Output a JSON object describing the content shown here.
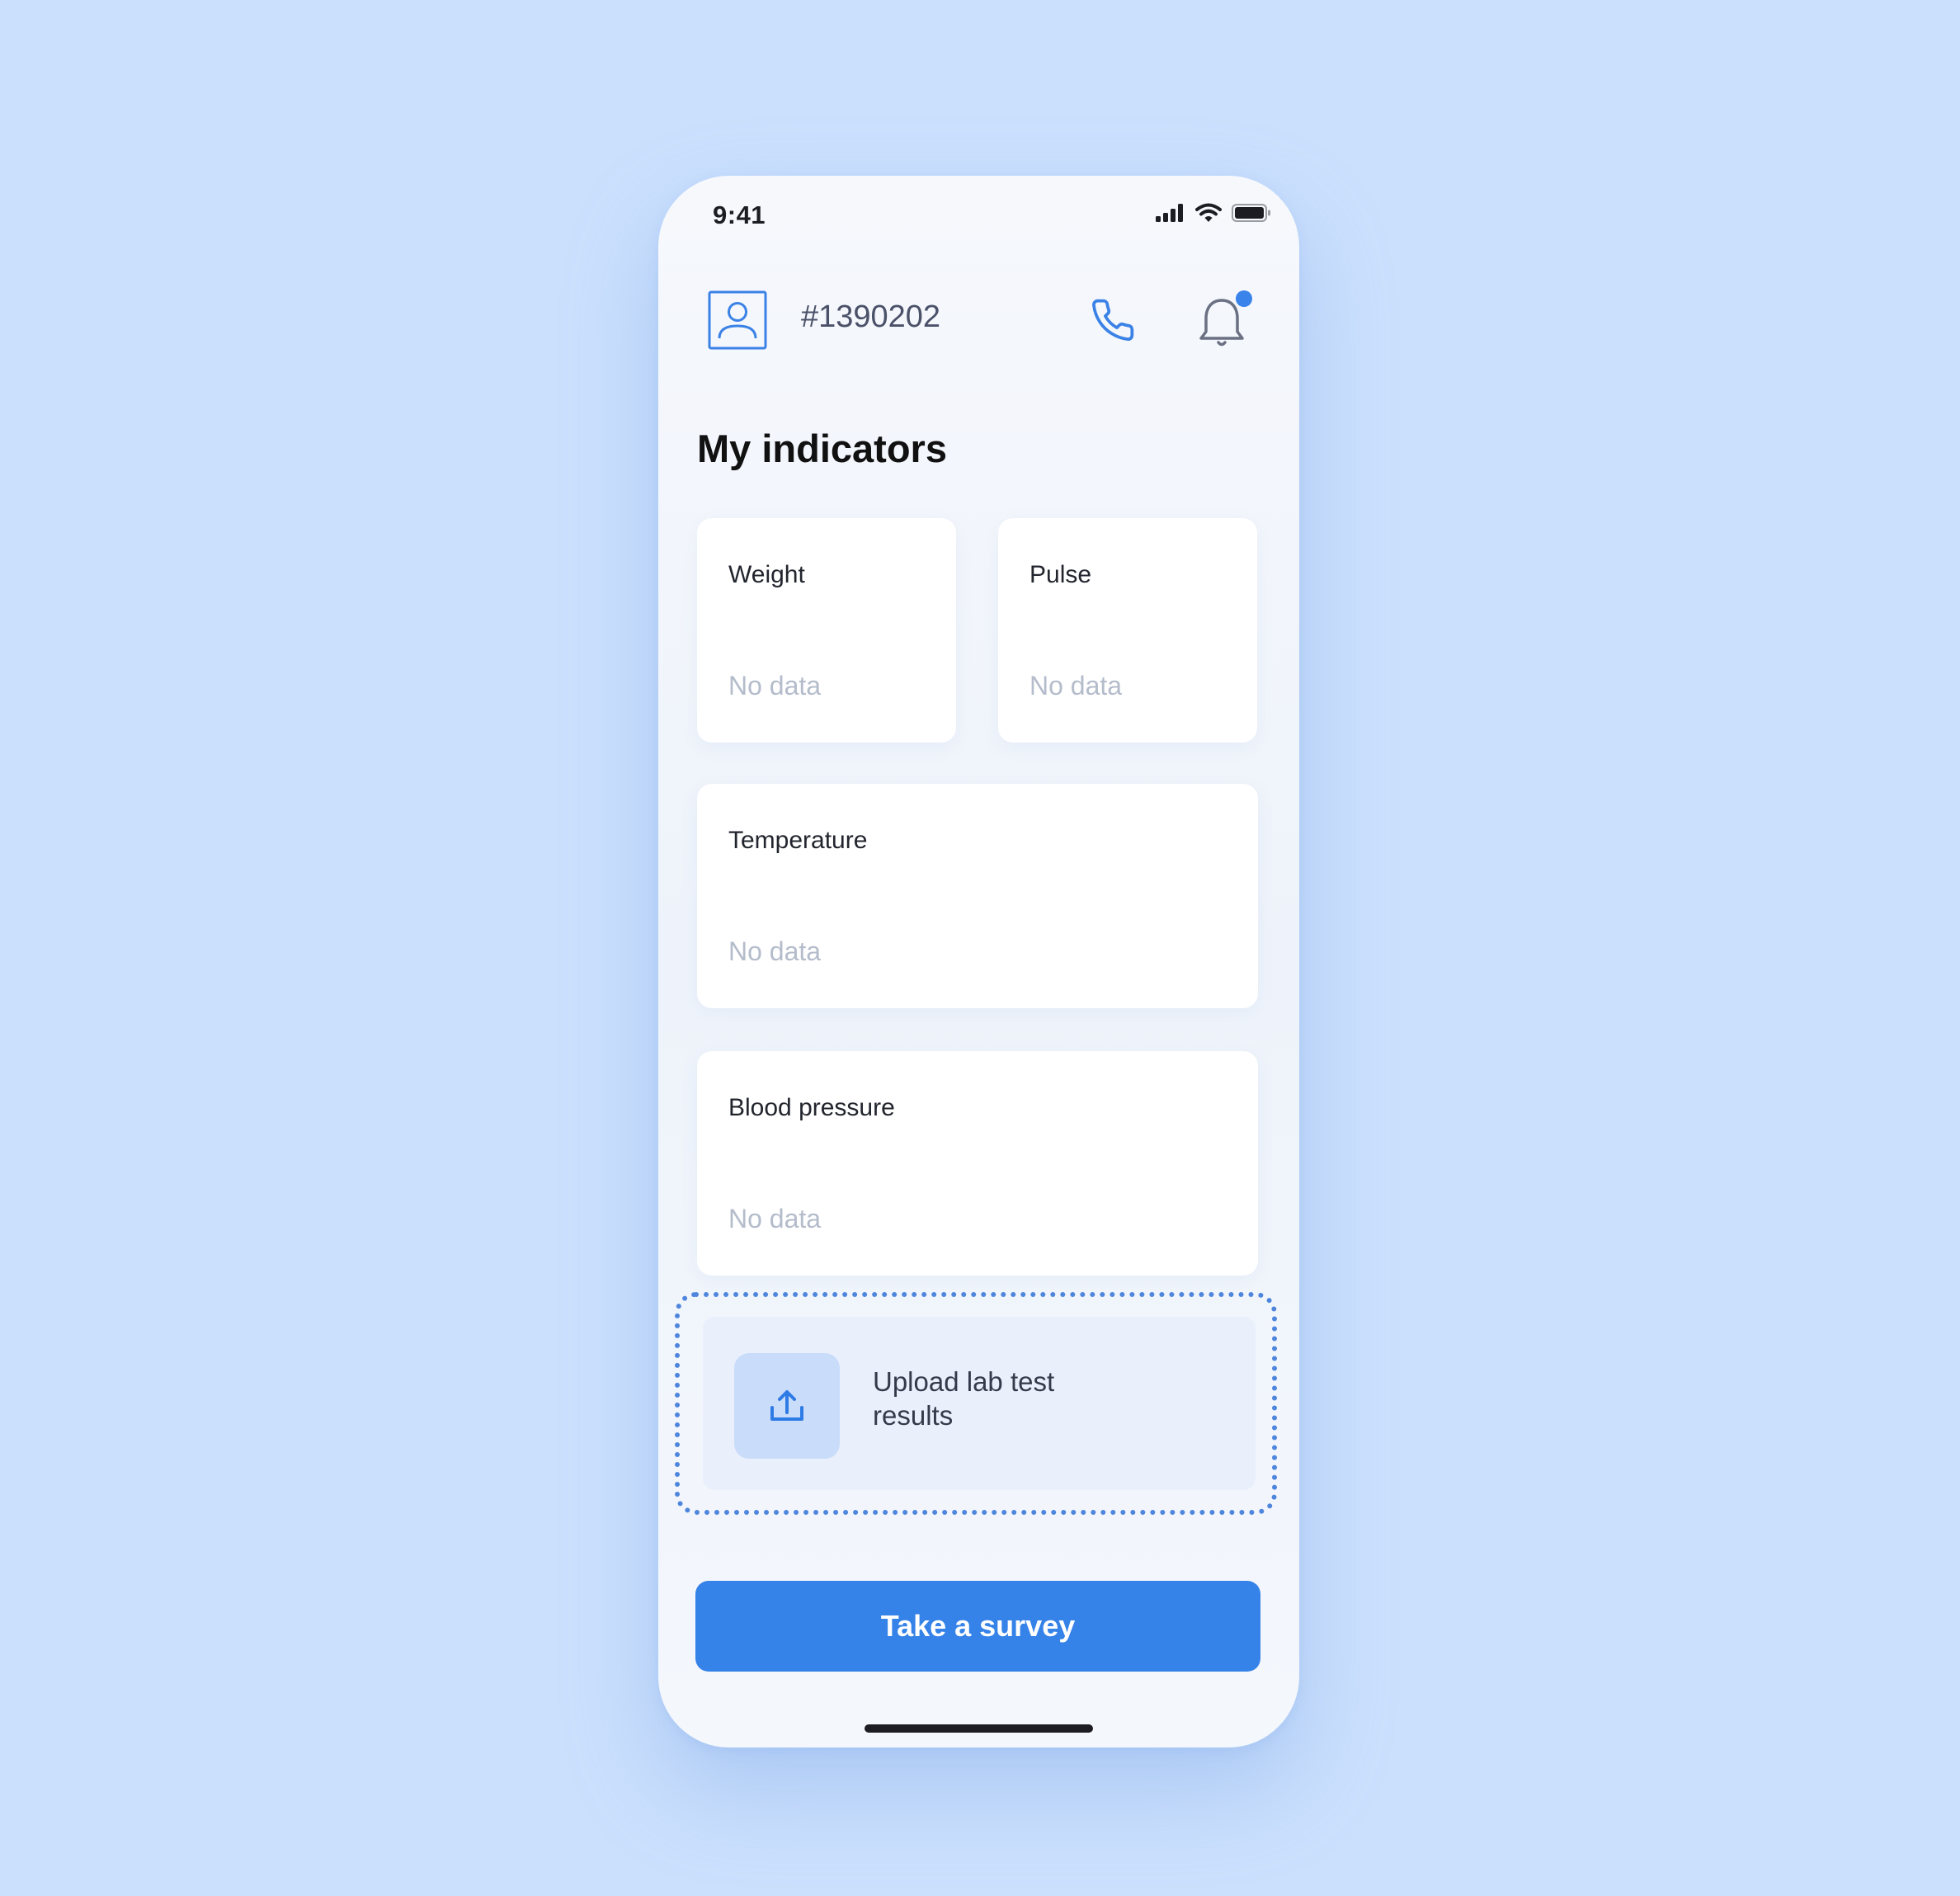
{
  "status_bar": {
    "time": "9:41"
  },
  "header": {
    "patient_id": "#1390202"
  },
  "page_title": "My indicators",
  "indicators": [
    {
      "label": "Weight",
      "value": "No data"
    },
    {
      "label": "Pulse",
      "value": "No data"
    },
    {
      "label": "Temperature",
      "value": "No data"
    },
    {
      "label": "Blood pressure",
      "value": "No data"
    }
  ],
  "upload": {
    "label": "Upload lab test results"
  },
  "survey_button": {
    "label": "Take a survey"
  },
  "colors": {
    "background": "#cbe0fd",
    "accent": "#3582e8",
    "dashed_border": "#4f86dd",
    "placeholder_text": "#b4bccb"
  },
  "icons": [
    "signal-icon",
    "wifi-icon",
    "battery-icon",
    "avatar-icon",
    "phone-icon",
    "bell-icon",
    "upload-icon"
  ]
}
